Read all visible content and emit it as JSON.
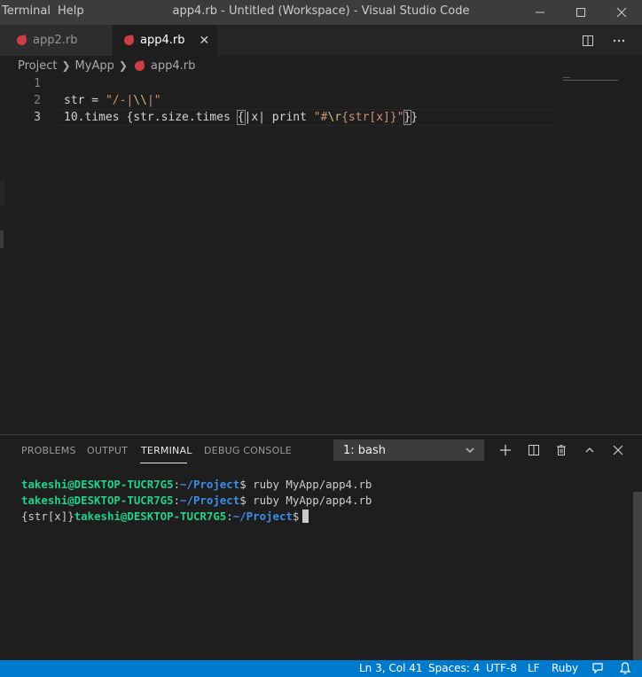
{
  "titlebar": {
    "menu": [
      "Terminal",
      "Help"
    ],
    "title": "app4.rb - Untitled (Workspace) - Visual Studio Code"
  },
  "tabs": [
    {
      "label": "app2.rb",
      "active": false,
      "icon": "ruby-file-icon"
    },
    {
      "label": "app4.rb",
      "active": true,
      "icon": "ruby-file-icon"
    }
  ],
  "breadcrumb": {
    "items": [
      "Project",
      "MyApp",
      "app4.rb"
    ]
  },
  "editor": {
    "line_numbers": [
      "1",
      "2",
      "3"
    ],
    "lines": [
      "",
      "str = \"/-|\\\\|\"",
      "10.times {str.size.times {|x| print \"#\\r{str[x]}\"}}"
    ]
  },
  "panel": {
    "tabs": [
      "PROBLEMS",
      "OUTPUT",
      "TERMINAL",
      "DEBUG CONSOLE"
    ],
    "active_tab": "TERMINAL",
    "terminal_selector": "1: bash",
    "terminal": {
      "user": "takeshi@DESKTOP-TUCR7G5",
      "path": "~/Project",
      "command": "ruby MyApp/app4.rb",
      "output": "{str[x]}"
    }
  },
  "statusbar": {
    "position": "Ln 3, Col 41",
    "spaces": "Spaces: 4",
    "encoding": "UTF-8",
    "eol": "LF",
    "language": "Ruby"
  },
  "colors": {
    "accent": "#007acc",
    "terminal_user": "#23d18b",
    "terminal_path": "#3b8eea",
    "ruby_icon": "#cc3e44"
  }
}
